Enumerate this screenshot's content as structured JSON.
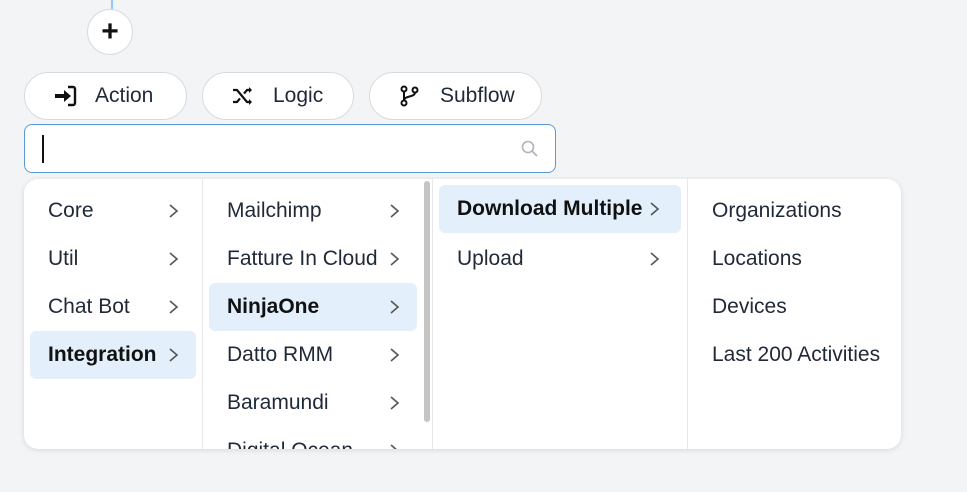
{
  "add_button": {
    "label": "+"
  },
  "types": [
    {
      "label": "Action",
      "icon": "sign-in-icon"
    },
    {
      "label": "Logic",
      "icon": "shuffle-icon"
    },
    {
      "label": "Subflow",
      "icon": "branch-icon"
    }
  ],
  "search": {
    "value": "",
    "placeholder": ""
  },
  "menu": {
    "col1": [
      {
        "label": "Core",
        "has_submenu": true
      },
      {
        "label": "Util",
        "has_submenu": true
      },
      {
        "label": "Chat Bot",
        "has_submenu": true
      },
      {
        "label": "Integration",
        "has_submenu": true,
        "selected": true
      }
    ],
    "col2": [
      {
        "label": "Mailchimp",
        "has_submenu": true
      },
      {
        "label": "Fatture In Cloud",
        "has_submenu": true
      },
      {
        "label": "NinjaOne",
        "has_submenu": true,
        "selected": true
      },
      {
        "label": "Datto RMM",
        "has_submenu": true
      },
      {
        "label": "Baramundi",
        "has_submenu": true
      },
      {
        "label": "Digital Ocean",
        "has_submenu": true
      }
    ],
    "col3": [
      {
        "label": "Download Multiple",
        "has_submenu": true,
        "selected": true
      },
      {
        "label": "Upload",
        "has_submenu": true
      }
    ],
    "col4": [
      {
        "label": "Organizations"
      },
      {
        "label": "Locations"
      },
      {
        "label": "Devices"
      },
      {
        "label": "Last 200 Activities"
      }
    ]
  },
  "colors": {
    "accent": "#5b9bd5",
    "selected_bg": "#e3f0fb"
  }
}
